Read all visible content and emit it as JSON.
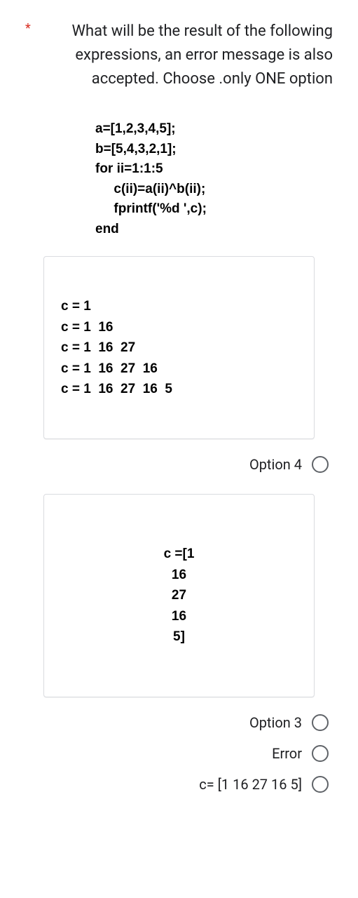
{
  "asterisk": "*",
  "question": "What will be the result of the following expressions, an error message is also accepted. Choose .only ONE option",
  "code": "a=[1,2,3,4,5];\nb=[5,4,3,2,1];\nfor ii=1:1:5\n     c(ii)=a(ii)^b(ii);\n     fprintf('%d ',c);\nend",
  "card1": "c = 1\nc = 1  16\nc = 1  16  27\nc = 1  16  27  16\nc = 1  16  27  16  5",
  "card2": "c =[1\n16\n27\n16\n5]",
  "options": {
    "opt4": "Option 4",
    "opt3": "Option 3",
    "err": "Error",
    "inline": "c= [1 16 27 16 5]"
  }
}
